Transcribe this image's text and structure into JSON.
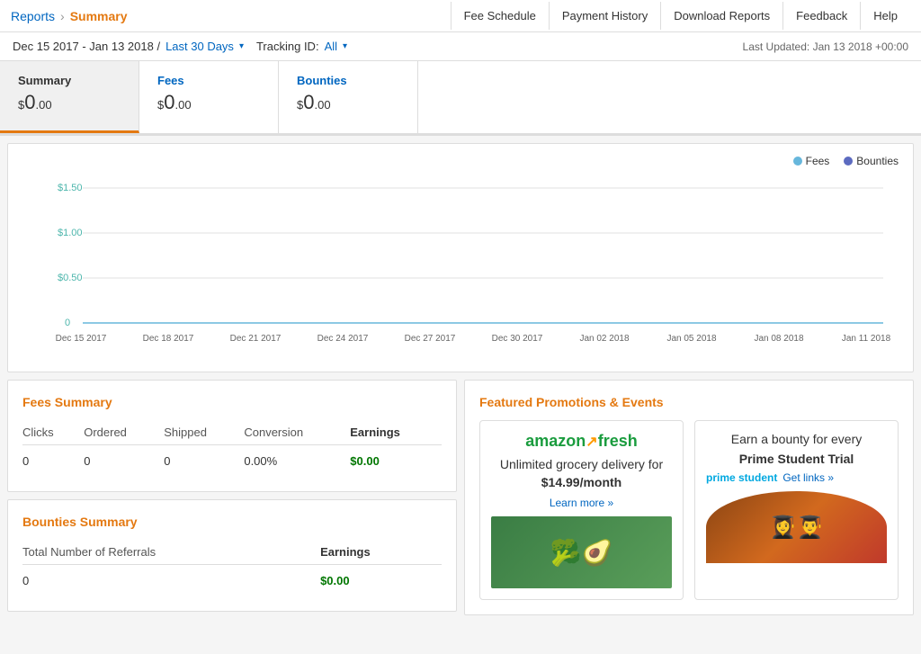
{
  "nav": {
    "reports_label": "Reports",
    "arrow": "›",
    "summary_label": "Summary",
    "links": [
      {
        "id": "fee-schedule",
        "label": "Fee Schedule"
      },
      {
        "id": "payment-history",
        "label": "Payment History"
      },
      {
        "id": "download-reports",
        "label": "Download Reports"
      },
      {
        "id": "feedback",
        "label": "Feedback"
      },
      {
        "id": "help",
        "label": "Help"
      }
    ]
  },
  "datebar": {
    "date_range": "Dec 15 2017 - Jan 13 2018 /",
    "last30": "Last 30 Days",
    "tracking_label": "Tracking ID:",
    "tracking_value": "All",
    "last_updated": "Last Updated: Jan 13 2018 +00:00"
  },
  "cards": {
    "summary": {
      "title": "Summary",
      "value_prefix": "$",
      "value_main": "0",
      "value_cents": ".00"
    },
    "fees": {
      "title": "Fees",
      "value_prefix": "$",
      "value_main": "0",
      "value_cents": ".00"
    },
    "bounties": {
      "title": "Bounties",
      "value_prefix": "$",
      "value_main": "0",
      "value_cents": ".00"
    }
  },
  "chart": {
    "legend": {
      "fees_label": "Fees",
      "bounties_label": "Bounties"
    },
    "y_labels": [
      "$1.50",
      "$1.00",
      "$0.50",
      "0"
    ],
    "x_labels": [
      "Dec 15 2017",
      "Dec 18 2017",
      "Dec 21 2017",
      "Dec 24 2017",
      "Dec 27 2017",
      "Dec 30 2017",
      "Jan 02 2018",
      "Jan 05 2018",
      "Jan 08 2018",
      "Jan 11 2018"
    ]
  },
  "fees_summary": {
    "title": "Fees Summary",
    "columns": [
      "Clicks",
      "Ordered",
      "Shipped",
      "Conversion",
      "Earnings"
    ],
    "values": {
      "clicks": "0",
      "ordered": "0",
      "shipped": "0",
      "conversion": "0.00%",
      "earnings": "$0.00"
    }
  },
  "bounties_summary": {
    "title": "Bounties Summary",
    "columns": [
      "Total Number of Referrals",
      "Earnings"
    ],
    "values": {
      "referrals": "0",
      "earnings": "$0.00"
    }
  },
  "featured": {
    "title": "Featured Promotions & Events",
    "promo1": {
      "brand": "amazonfresh",
      "text": "Unlimited grocery delivery for $14.99/month",
      "link": "Learn more »"
    },
    "promo2": {
      "text1": "Earn a bounty for every",
      "text2": "Prime Student Trial",
      "brand": "prime student",
      "link": "Get links »"
    }
  }
}
